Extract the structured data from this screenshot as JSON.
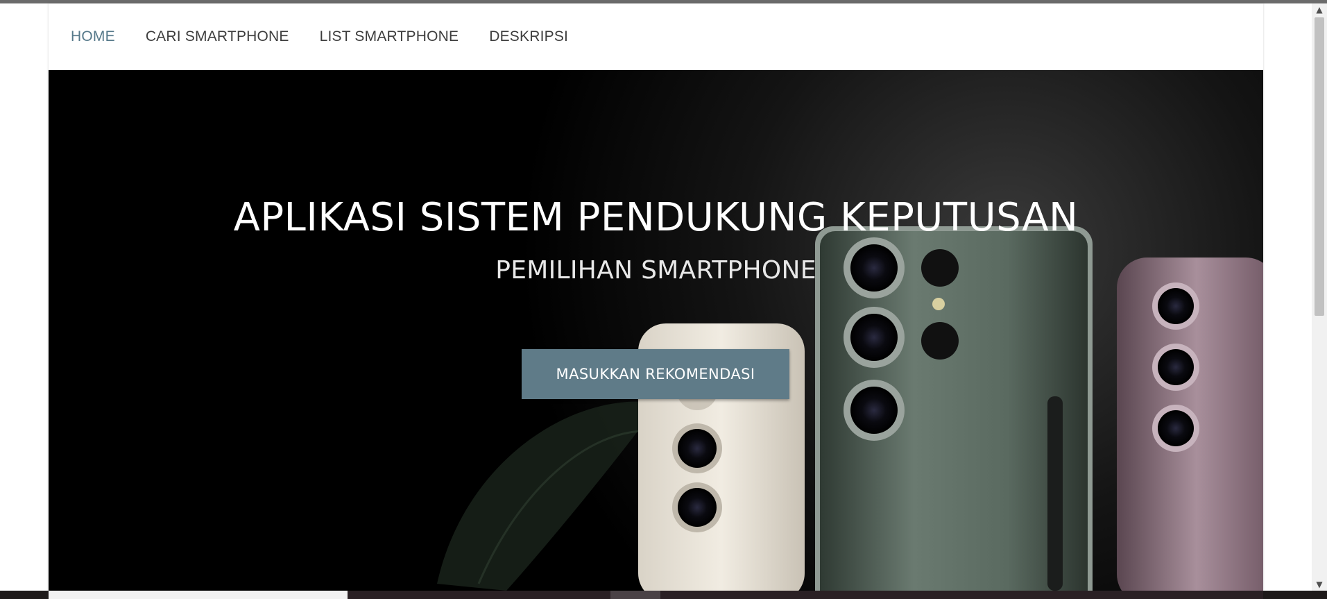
{
  "nav": {
    "items": [
      {
        "label": "HOME",
        "active": true
      },
      {
        "label": "CARI SMARTPHONE",
        "active": false
      },
      {
        "label": "LIST SMARTPHONE",
        "active": false
      },
      {
        "label": "DESKRIPSI",
        "active": false
      }
    ]
  },
  "hero": {
    "title": "APLIKASI SISTEM PENDUKUNG KEPUTUSAN",
    "subtitle": "PEMILIHAN SMARTPHONE",
    "button_label": "MASUKKAN REKOMENDASI",
    "image_description_icon": "smartphones-image"
  },
  "colors": {
    "nav_active": "#56798a",
    "nav_text": "#3d3d3d",
    "button_bg": "#5f7b88",
    "hero_bg": "#000000"
  },
  "scrollbar": {
    "up_icon": "chevron-up-icon",
    "down_icon": "chevron-down-icon"
  }
}
